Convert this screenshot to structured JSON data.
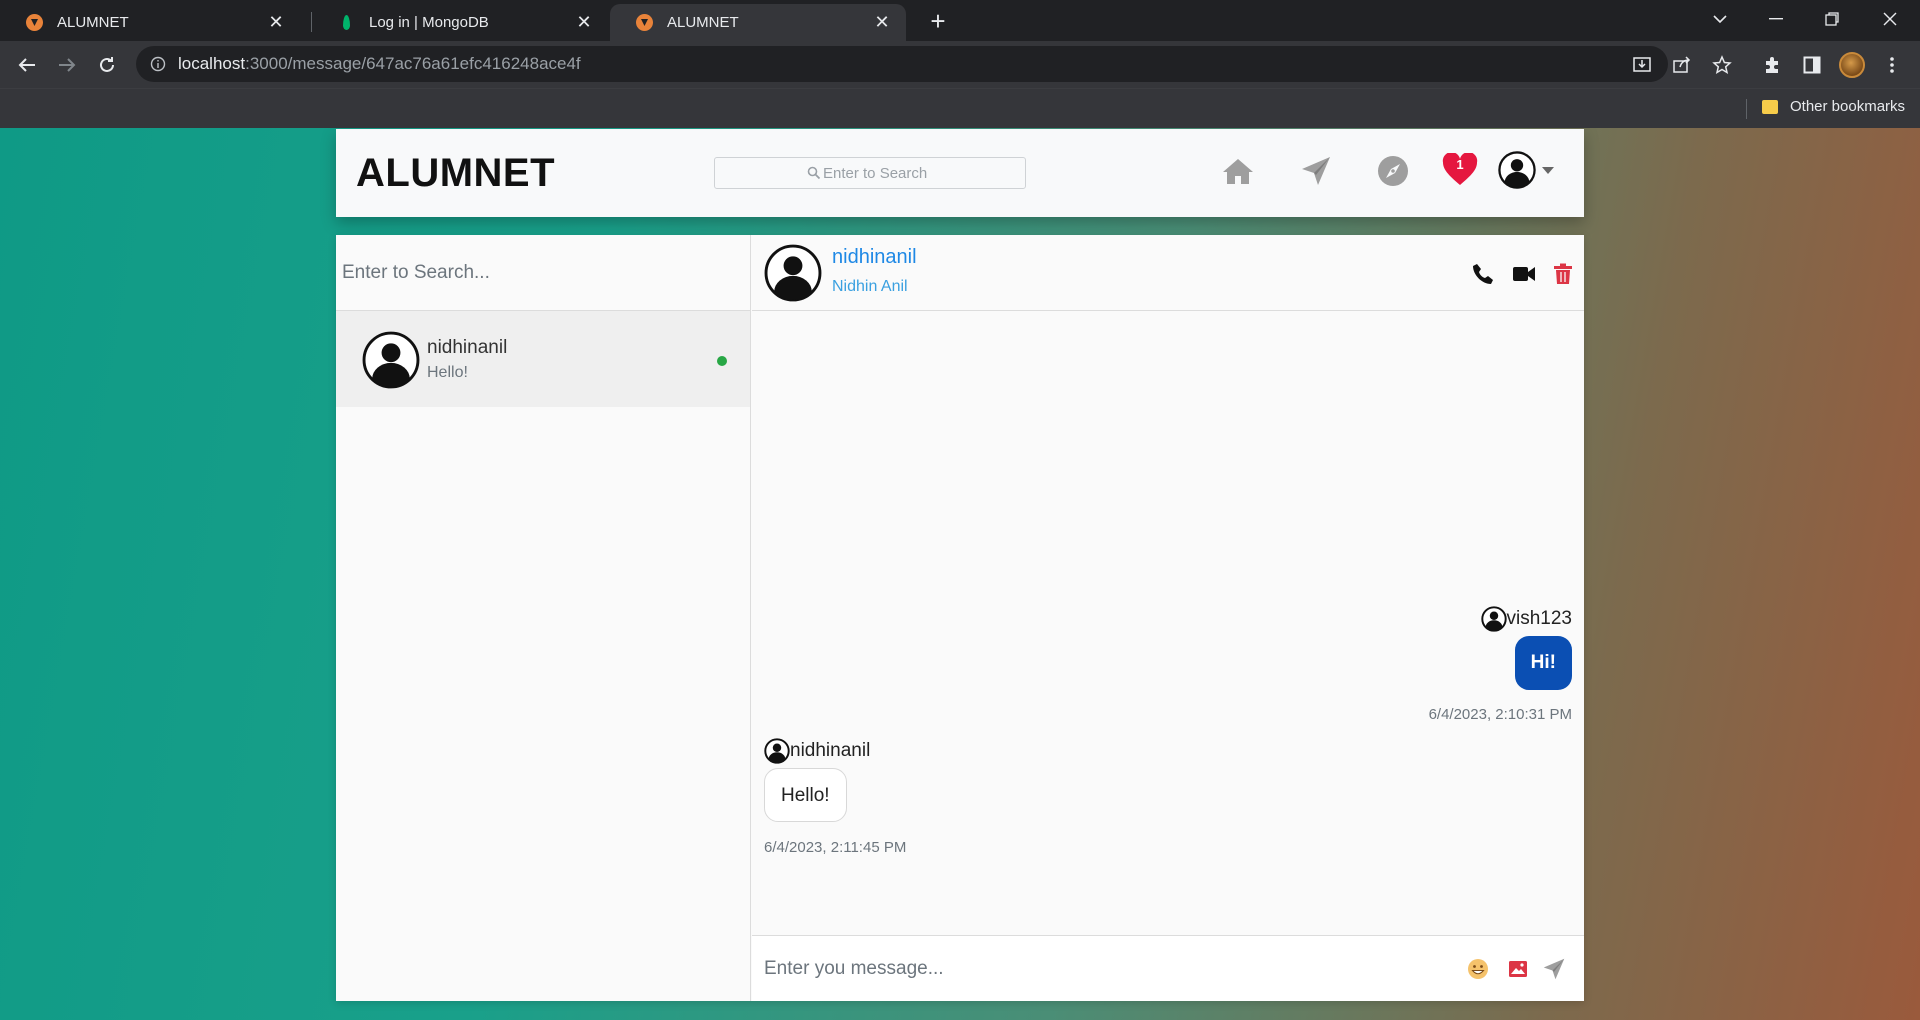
{
  "browser": {
    "tabs": [
      {
        "title": "ALUMNET",
        "active": false,
        "favicon": "alumnet-icon"
      },
      {
        "title": "Log in | MongoDB",
        "active": false,
        "favicon": "mongodb-leaf-icon"
      },
      {
        "title": "ALUMNET",
        "active": true,
        "favicon": "alumnet-icon"
      }
    ],
    "url_host": "localhost",
    "url_rest": ":3000/message/647ac76a61efc416248ace4f",
    "bookmarks": {
      "other_label": "Other bookmarks"
    }
  },
  "app": {
    "brand": "ALUMNET",
    "search_placeholder": "Enter to Search",
    "notification_count": "1"
  },
  "sidebar": {
    "search_placeholder": "Enter to Search...",
    "contacts": [
      {
        "username": "nidhinanil",
        "last_message": "Hello!",
        "online": true
      }
    ]
  },
  "chat": {
    "header": {
      "username": "nidhinanil",
      "fullname": "Nidhin Anil"
    },
    "messages": [
      {
        "sender": "vish123",
        "text": "Hi!",
        "time": "6/4/2023, 2:10:31 PM",
        "outgoing": true
      },
      {
        "sender": "nidhinanil",
        "text": "Hello!",
        "time": "6/4/2023, 2:11:45 PM",
        "outgoing": false
      }
    ],
    "composer_placeholder": "Enter you message..."
  },
  "colors": {
    "outgoing_bubble": "#0b4fb3",
    "heart": "#e5173f",
    "delete": "#dc3545",
    "online": "#28a745",
    "link": "#1e88e5"
  }
}
